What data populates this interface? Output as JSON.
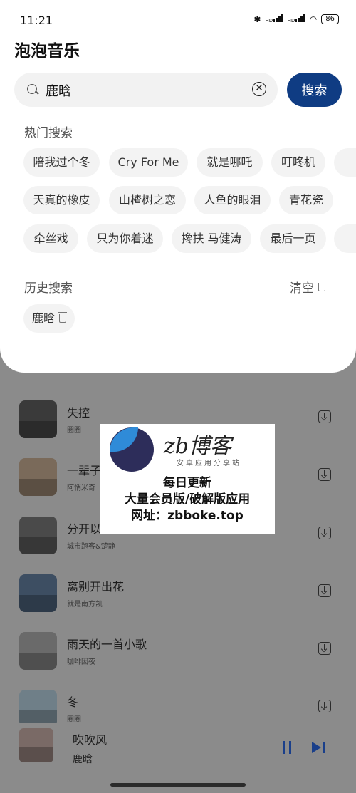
{
  "status_bar": {
    "time": "11:21",
    "bluetooth": "bluetooth-icon",
    "signal1": "HD",
    "signal2": "HD",
    "wifi": "wifi-icon",
    "battery": "86"
  },
  "app": {
    "title": "泡泡音乐"
  },
  "search": {
    "value": "鹿晗",
    "clear_icon": "close-circle-icon",
    "button_label": "搜索"
  },
  "hot": {
    "title": "热门搜索",
    "chips": [
      "陪我过个冬",
      "Cry For Me",
      "就是哪吒",
      "叮咚机",
      "天真的橡皮",
      "山楂树之恋",
      "人鱼的眼泪",
      "青花瓷",
      "牵丝戏",
      "只为你着迷",
      "搀扶 马健涛",
      "最后一页"
    ]
  },
  "history": {
    "title": "历史搜索",
    "clear_label": "清空",
    "items": [
      "鹿晗"
    ]
  },
  "songs": [
    {
      "title": "失控",
      "artist": "圈圈"
    },
    {
      "title": "一辈子",
      "artist": "阿悄米奇"
    },
    {
      "title": "分开以",
      "artist": "城市跑客&楚静"
    },
    {
      "title": "离别开出花",
      "artist": "就是南方凯"
    },
    {
      "title": "雨天的一首小歌",
      "artist": "咖啡因夜"
    },
    {
      "title": "冬",
      "artist": "圈圈"
    }
  ],
  "player": {
    "title": "吹吹风",
    "artist": "鹿晗",
    "play_state": "playing"
  },
  "watermark": {
    "brand": "zb博客",
    "brand_sub": "安卓应用分享站",
    "line1": "每日更新",
    "line2": "大量会员版/破解版应用",
    "line3": "网址：zbboke.top"
  },
  "colors": {
    "accent": "#0f3c83",
    "player_control": "#1a3f8a"
  }
}
